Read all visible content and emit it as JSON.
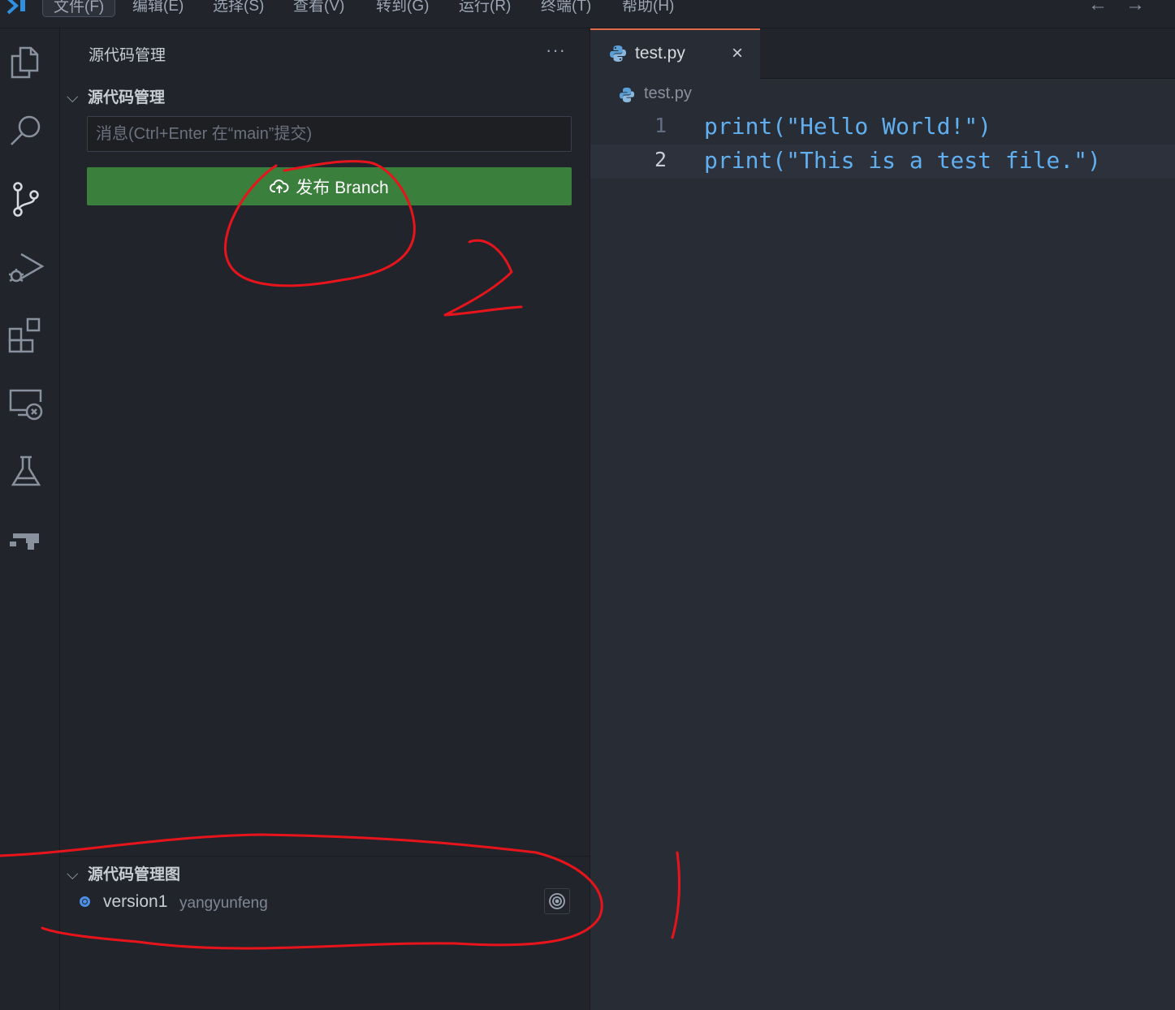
{
  "menubar": {
    "items": [
      "文件(F)",
      "编辑(E)",
      "选择(S)",
      "查看(V)",
      "转到(G)",
      "运行(R)",
      "终端(T)",
      "帮助(H)"
    ],
    "back": "←",
    "forward": "→"
  },
  "activity_bar": {
    "icons": [
      "explorer-icon",
      "search-icon",
      "source-control-icon",
      "run-debug-icon",
      "extensions-icon",
      "remote-explorer-icon",
      "testing-icon",
      "gitlens-icon"
    ]
  },
  "sidebar": {
    "title": "源代码管理",
    "more": "···",
    "scm_section": "源代码管理",
    "commit_placeholder": "消息(Ctrl+Enter 在“main”提交)",
    "publish_label": "发布 Branch",
    "graph_section": "源代码管理图",
    "graph_items": [
      {
        "name": "version1",
        "author": "yangyunfeng"
      }
    ]
  },
  "editor": {
    "tab_label": "test.py",
    "tab_close": "×",
    "breadcrumb": "test.py",
    "lines": [
      {
        "number": "1",
        "code": "print(\"Hello World!\")"
      },
      {
        "number": "2",
        "code": "print(\"This is a test file.\")"
      }
    ]
  },
  "annotations": {
    "marks": [
      "2",
      "1"
    ],
    "color": "#e8141c"
  },
  "colors": {
    "publish_button": "#3a7f3c",
    "tab_accent": "#e06c4b",
    "code_text": "#61afef",
    "graph_dot": "#4d8fe6"
  }
}
